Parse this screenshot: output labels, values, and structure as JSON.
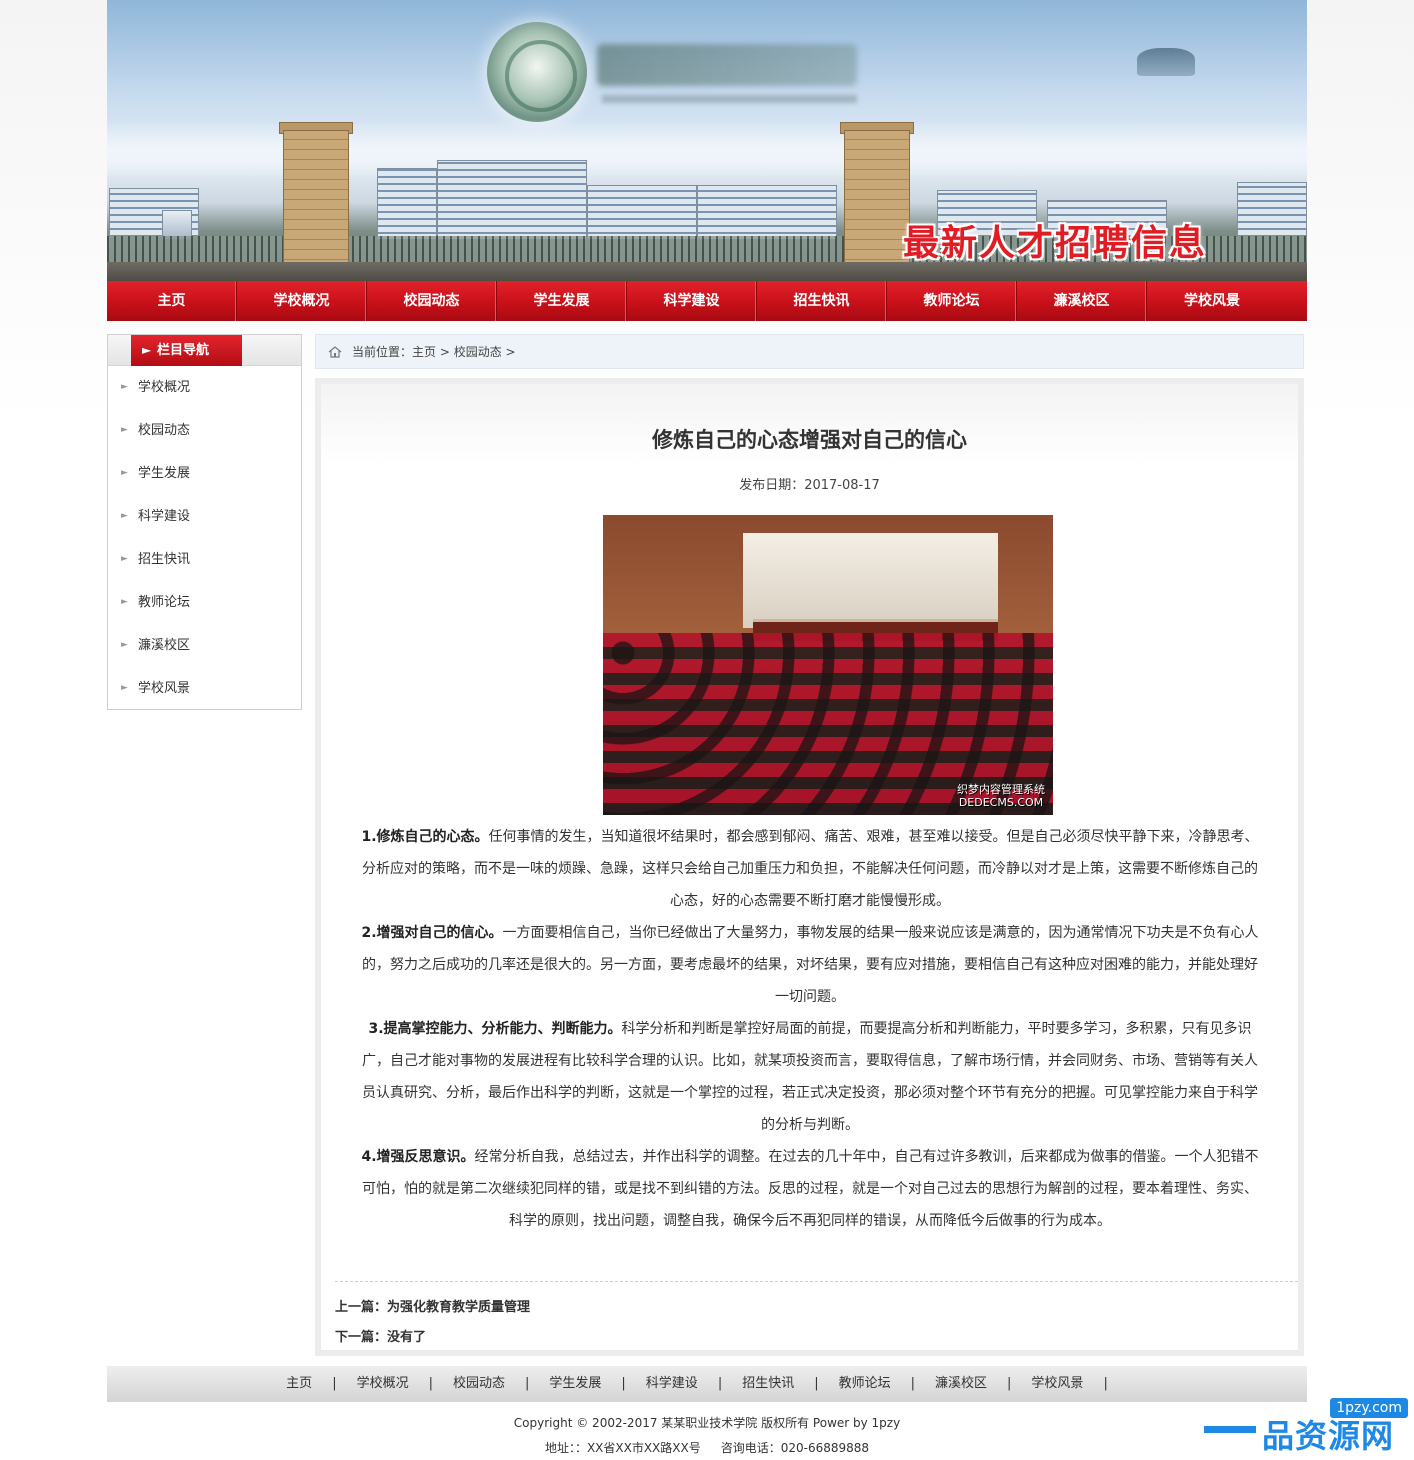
{
  "banner": {
    "slogan": "最新人才招聘信息"
  },
  "nav": {
    "items": [
      "主页",
      "学校概况",
      "校园动态",
      "学生发展",
      "科学建设",
      "招生快讯",
      "教师论坛",
      "濂溪校区",
      "学校风景"
    ]
  },
  "sidebar": {
    "title": "栏目导航",
    "items": [
      "学校概况",
      "校园动态",
      "学生发展",
      "科学建设",
      "招生快讯",
      "教师论坛",
      "濂溪校区",
      "学校风景"
    ]
  },
  "breadcrumb": {
    "prefix": "当前位置：",
    "home": "主页",
    "sep1": " > ",
    "section": "校园动态",
    "sep2": " >"
  },
  "article": {
    "title": "修炼自己的心态增强对自己的信心",
    "date": "发布日期：2017-08-17",
    "photo_watermark_1": "织梦内容管理系统",
    "photo_watermark_2": "DEDECMS.COM",
    "paragraphs": [
      {
        "head": "1.修炼自己的心态。",
        "text": "任何事情的发生，当知道很坏结果时，都会感到郁闷、痛苦、艰难，甚至难以接受。但是自己必须尽快平静下来，冷静思考、分析应对的策略，而不是一味的烦躁、急躁，这样只会给自己加重压力和负担，不能解决任何问题，而冷静以对才是上策，这需要不断修炼自己的心态，好的心态需要不断打磨才能慢慢形成。"
      },
      {
        "head": "2.增强对自己的信心。",
        "text": "一方面要相信自己，当你已经做出了大量努力，事物发展的结果一般来说应该是满意的，因为通常情况下功夫是不负有心人的，努力之后成功的几率还是很大的。另一方面，要考虑最坏的结果，对坏结果，要有应对措施，要相信自己有这种应对困难的能力，并能处理好一切问题。"
      },
      {
        "head": "3.提高掌控能力、分析能力、判断能力。",
        "text": "科学分析和判断是掌控好局面的前提，而要提高分析和判断能力，平时要多学习，多积累，只有见多识广，自己才能对事物的发展进程有比较科学合理的认识。比如，就某项投资而言，要取得信息，了解市场行情，并会同财务、市场、营销等有关人员认真研究、分析，最后作出科学的判断，这就是一个掌控的过程，若正式决定投资，那必须对整个环节有充分的把握。可见掌控能力来自于科学的分析与判断。"
      },
      {
        "head": "4.增强反思意识。",
        "text": "经常分析自我，总结过去，并作出科学的调整。在过去的几十年中，自己有过许多教训，后来都成为做事的借鉴。一个人犯错不可怕，怕的就是第二次继续犯同样的错，或是找不到纠错的方法。反思的过程，就是一个对自己过去的思想行为解剖的过程，要本着理性、务实、科学的原则，找出问题，调整自我，确保今后不再犯同样的错误，从而降低今后做事的行为成本。"
      }
    ],
    "prev_label": "上一篇：",
    "prev_title": "为强化教育教学质量管理",
    "next_label": "下一篇：",
    "next_title": "没有了"
  },
  "footer": {
    "links": [
      "主页",
      "学校概况",
      "校园动态",
      "学生发展",
      "科学建设",
      "招生快讯",
      "教师论坛",
      "濂溪校区",
      "学校风景"
    ],
    "copyright": "Copyright © 2002-2017 某某职业技术学院 版权所有 Power by 1pzy",
    "address": "地址：：XX省XX市XX路XX号",
    "phone": "咨询电话：020-66889888"
  },
  "corner_watermark": {
    "url": "1pzy.com",
    "name": "品资源网"
  },
  "colors": {
    "nav_red": "#c8101a",
    "slogan_red": "#e01d24",
    "watermark_blue": "#1e88e5"
  }
}
